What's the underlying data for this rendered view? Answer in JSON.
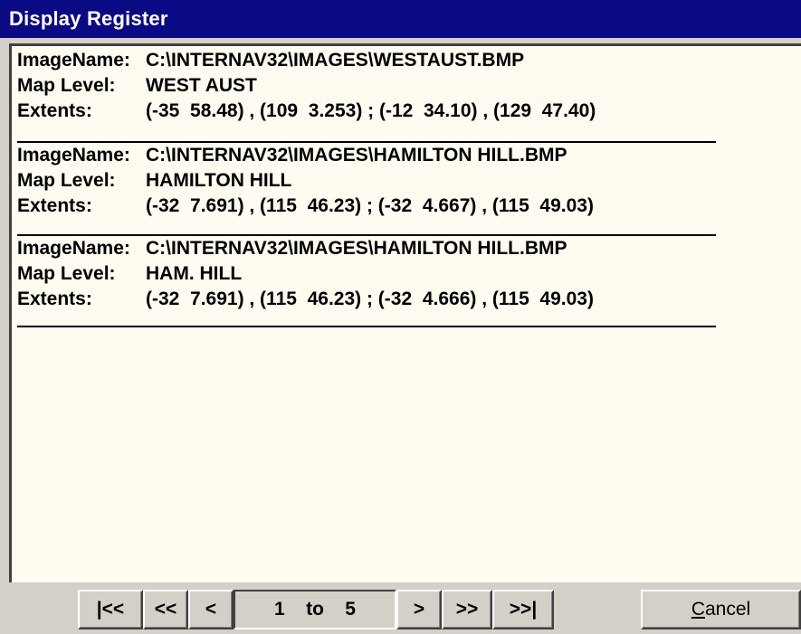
{
  "window": {
    "title": "Display Register"
  },
  "records": [
    {
      "image_label": "ImageName:",
      "image_value": "C:\\INTERNAV32\\IMAGES\\WESTAUST.BMP",
      "level_label": "Map Level:",
      "level_value": "WEST AUST",
      "extents_label": "Extents:",
      "extents_value": "(-35  58.48) , (109  3.253) ; (-12  34.10) , (129  47.40)"
    },
    {
      "image_label": "ImageName:",
      "image_value": "C:\\INTERNAV32\\IMAGES\\HAMILTON HILL.BMP",
      "level_label": "Map Level:",
      "level_value": "HAMILTON HILL",
      "extents_label": "Extents:",
      "extents_value": "(-32  7.691) , (115  46.23) ; (-32  4.667) , (115  49.03)"
    },
    {
      "image_label": "ImageName:",
      "image_value": "C:\\INTERNAV32\\IMAGES\\HAMILTON HILL.BMP",
      "level_label": "Map Level:",
      "level_value": "HAM. HILL",
      "extents_label": "Extents:",
      "extents_value": "(-32  7.691) , (115  46.23) ; (-32  4.666) , (115  49.03)"
    }
  ],
  "nav": {
    "first_label": "|<<",
    "prev_page_label": "<<",
    "prev_label": "<",
    "range_from": "1",
    "range_to_word": "to",
    "range_to": "5",
    "next_label": ">",
    "next_page_label": ">>",
    "last_label": ">>|"
  },
  "cancel": {
    "accel": "C",
    "rest": "ancel"
  }
}
